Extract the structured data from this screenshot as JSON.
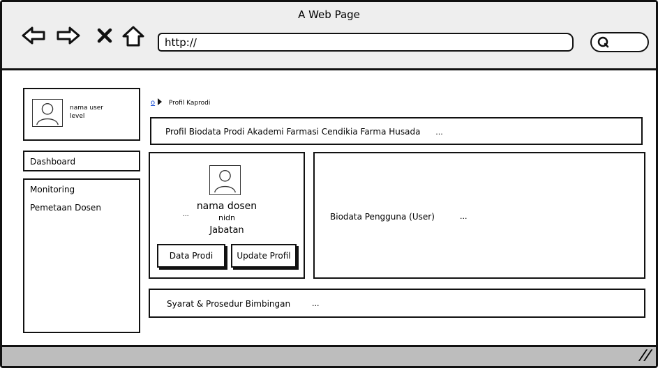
{
  "window": {
    "title": "A Web Page"
  },
  "browser": {
    "url": "http://",
    "icons": [
      "back-arrow-icon",
      "forward-arrow-icon",
      "close-x-icon",
      "home-icon",
      "search-icon"
    ]
  },
  "user_panel": {
    "name": "nama user",
    "role": "level"
  },
  "sidebar": {
    "dashboard": "Dashboard",
    "menu": [
      {
        "label": "Monitoring"
      },
      {
        "label": "Pemetaan Dosen"
      }
    ]
  },
  "breadcrumb": {
    "home": "o",
    "current": "Profil Kaprodi"
  },
  "profil": {
    "title": "Profil Biodata Prodi Akademi Farmasi Cendikia Farma Husada",
    "ellipsis": "..."
  },
  "card": {
    "name": "nama dosen",
    "nidn": "nidn",
    "nidn_prefix": "...",
    "jabatan": "Jabatan",
    "btn_data_prodi": "Data Prodi",
    "btn_update_profil": "Update Profil"
  },
  "biodata": {
    "title": "Biodata Pengguna (User)",
    "ellipsis": "..."
  },
  "syarat": {
    "title": "Syarat & Prosedur Bimbingan",
    "ellipsis": "..."
  },
  "footer": {
    "handle": "//"
  }
}
